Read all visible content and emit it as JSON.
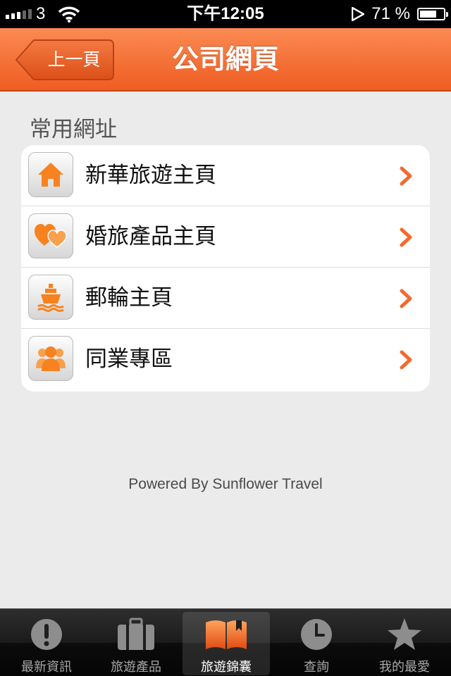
{
  "status_bar": {
    "carrier": "3",
    "time": "下午12:05",
    "battery": "71 %",
    "battery_level": 0.71
  },
  "nav": {
    "back_label": "上一頁",
    "title": "公司網頁"
  },
  "section": {
    "title": "常用網址",
    "items": [
      {
        "label": "新華旅遊主頁",
        "icon": "home-icon"
      },
      {
        "label": "婚旅產品主頁",
        "icon": "hearts-icon"
      },
      {
        "label": "郵輪主頁",
        "icon": "cruise-ship-icon"
      },
      {
        "label": "同業專區",
        "icon": "people-icon"
      }
    ]
  },
  "footer": {
    "powered_by": "Powered By Sunflower Travel"
  },
  "tabbar": {
    "tabs": [
      {
        "label": "最新資訊",
        "icon": "exclamation-icon",
        "selected": false
      },
      {
        "label": "旅遊產品",
        "icon": "suitcase-icon",
        "selected": false
      },
      {
        "label": "旅遊錦囊",
        "icon": "book-icon",
        "selected": true
      },
      {
        "label": "查詢",
        "icon": "clock-icon",
        "selected": false
      },
      {
        "label": "我的最愛",
        "icon": "star-icon",
        "selected": false
      }
    ]
  },
  "colors": {
    "accent": "#f26a2e",
    "nav_top": "#fb8a52",
    "nav_bottom": "#ef5d22"
  }
}
